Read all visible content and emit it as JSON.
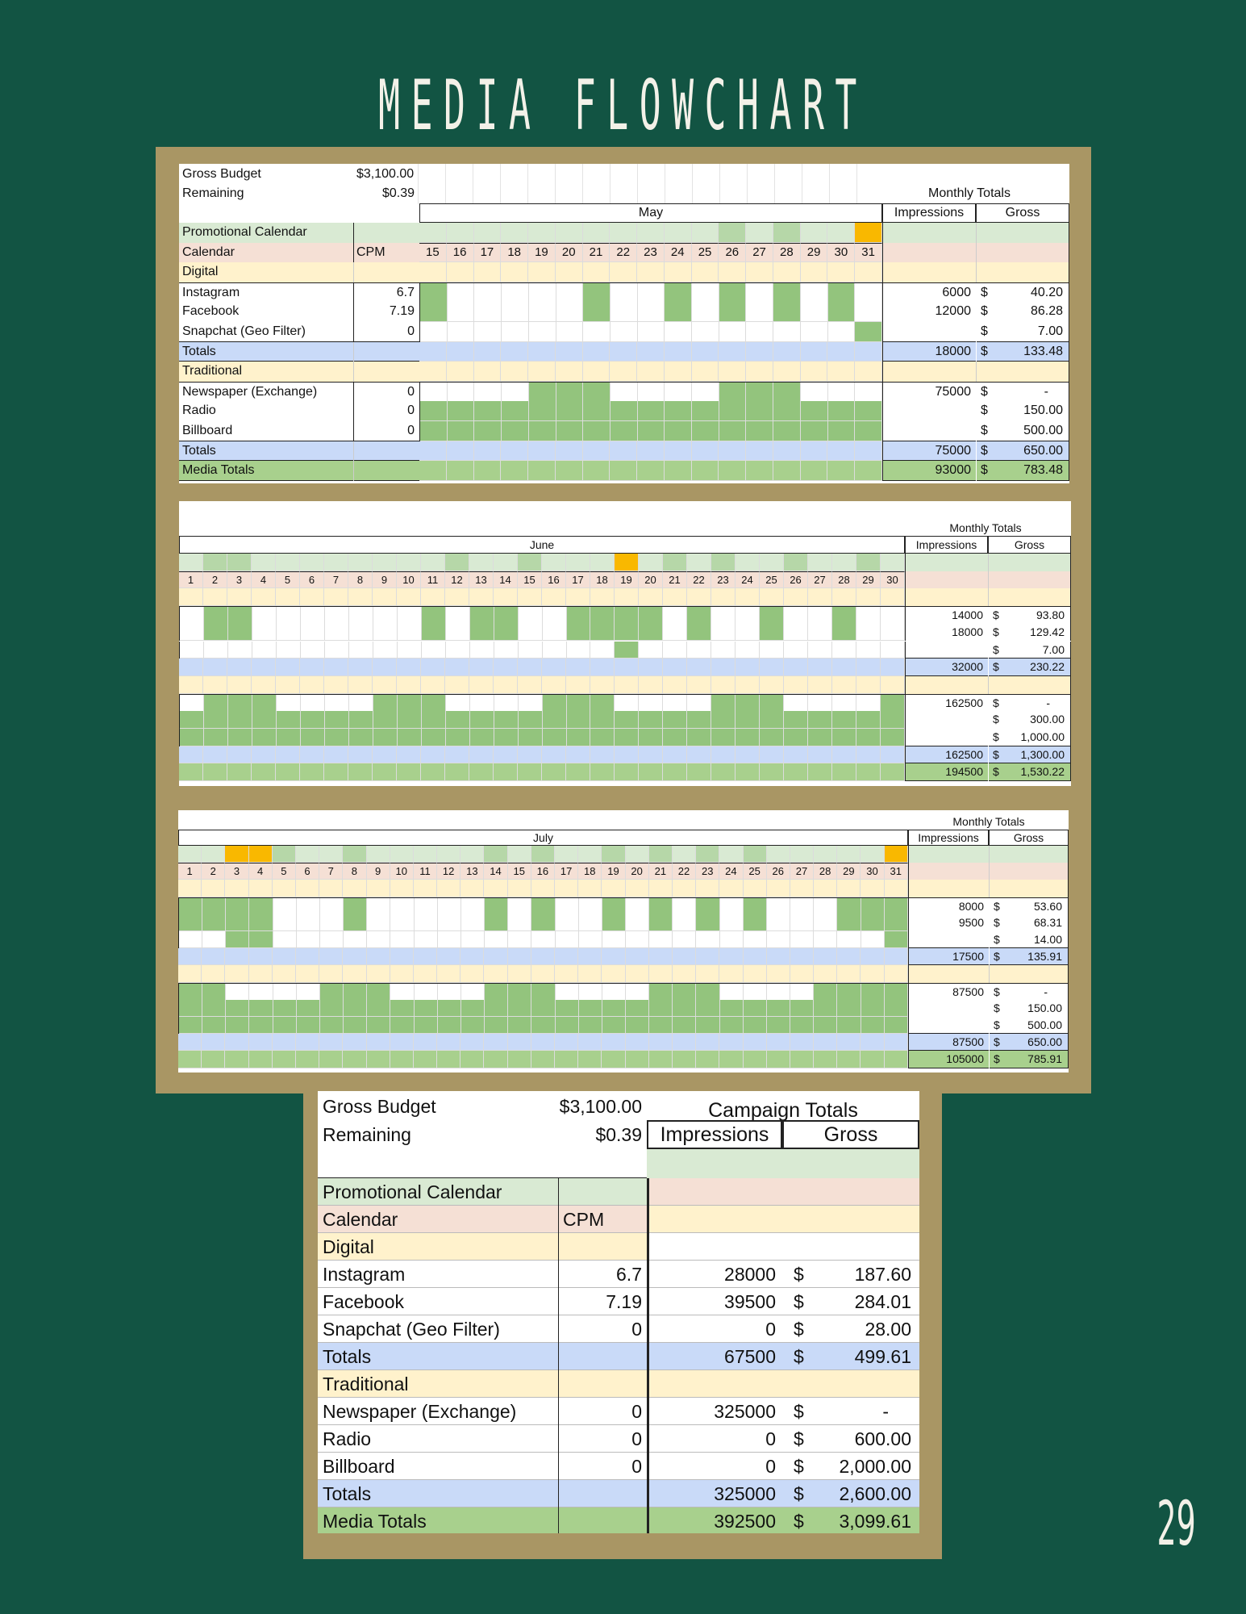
{
  "title": "MEDIA FLOWCHART",
  "page_number": "29",
  "colors": {
    "background": "#125443",
    "frame": "#a99664",
    "active_day": "#93c47d",
    "promo_light": "#d9ead3",
    "promo_mid": "#b6d7a8",
    "highlight_day": "#f9b800",
    "calendar_row": "#f5e0d5",
    "section_row": "#fff2cc",
    "totals_row": "#c9daf8",
    "media_totals_row": "#a8d08d"
  },
  "labels": {
    "gross_budget": "Gross Budget",
    "gross_budget_value": "$3,100.00",
    "remaining": "Remaining",
    "remaining_value": "$0.39",
    "promotional_calendar": "Promotional Calendar",
    "calendar": "Calendar",
    "cpm": "CPM",
    "digital": "Digital",
    "traditional": "Traditional",
    "totals": "Totals",
    "media_totals": "Media Totals",
    "monthly_totals": "Monthly Totals",
    "campaign_totals": "Campaign Totals",
    "impressions": "Impressions",
    "gross": "Gross",
    "currency": "$"
  },
  "media": [
    {
      "name": "Instagram",
      "cpm": "6.7"
    },
    {
      "name": "Facebook",
      "cpm": "7.19"
    },
    {
      "name": "Snapchat (Geo Filter)",
      "cpm": "0"
    },
    {
      "name": "Newspaper (Exchange)",
      "cpm": "0"
    },
    {
      "name": "Radio",
      "cpm": "0"
    },
    {
      "name": "Billboard",
      "cpm": "0"
    }
  ],
  "may": {
    "month": "May",
    "days": [
      "15",
      "16",
      "17",
      "18",
      "19",
      "20",
      "21",
      "22",
      "23",
      "24",
      "25",
      "26",
      "27",
      "28",
      "29",
      "30",
      "31"
    ],
    "promo": [
      0,
      0,
      0,
      0,
      0,
      0,
      0,
      0,
      0,
      0,
      0,
      2,
      0,
      2,
      0,
      0,
      3
    ],
    "schedule": [
      [
        1,
        0,
        0,
        0,
        0,
        0,
        1,
        0,
        0,
        1,
        0,
        1,
        0,
        1,
        0,
        1,
        0
      ],
      [
        1,
        0,
        0,
        0,
        0,
        0,
        1,
        0,
        0,
        1,
        0,
        1,
        0,
        1,
        0,
        1,
        0
      ],
      [
        0,
        0,
        0,
        0,
        0,
        0,
        0,
        0,
        0,
        0,
        0,
        0,
        0,
        0,
        0,
        0,
        1
      ],
      [
        0,
        0,
        0,
        0,
        1,
        1,
        1,
        0,
        0,
        0,
        0,
        1,
        1,
        1,
        0,
        0,
        0
      ],
      [
        1,
        1,
        1,
        1,
        1,
        1,
        1,
        1,
        1,
        1,
        1,
        1,
        1,
        1,
        1,
        1,
        1
      ],
      [
        1,
        1,
        1,
        1,
        1,
        1,
        1,
        1,
        1,
        1,
        1,
        1,
        1,
        1,
        1,
        1,
        1
      ]
    ],
    "values": [
      {
        "impressions": "6000",
        "gross": "40.20"
      },
      {
        "impressions": "12000",
        "gross": "86.28"
      },
      {
        "impressions": "",
        "gross": "7.00"
      },
      {
        "impressions": "18000",
        "gross": "133.48"
      },
      {
        "impressions": "75000",
        "gross": "-"
      },
      {
        "impressions": "",
        "gross": "150.00"
      },
      {
        "impressions": "",
        "gross": "500.00"
      },
      {
        "impressions": "75000",
        "gross": "650.00"
      },
      {
        "impressions": "93000",
        "gross": "783.48"
      }
    ]
  },
  "june": {
    "month": "June",
    "days": [
      "1",
      "2",
      "3",
      "4",
      "5",
      "6",
      "7",
      "8",
      "9",
      "10",
      "11",
      "12",
      "13",
      "14",
      "15",
      "16",
      "17",
      "18",
      "19",
      "20",
      "21",
      "22",
      "23",
      "24",
      "25",
      "26",
      "27",
      "28",
      "29",
      "30"
    ],
    "promo": [
      1,
      2,
      2,
      1,
      1,
      1,
      1,
      1,
      1,
      1,
      1,
      2,
      1,
      1,
      2,
      1,
      1,
      1,
      3,
      1,
      2,
      1,
      2,
      1,
      1,
      2,
      1,
      1,
      2,
      1
    ],
    "schedule": [
      [
        0,
        1,
        1,
        0,
        0,
        0,
        0,
        0,
        0,
        0,
        1,
        0,
        1,
        1,
        0,
        0,
        1,
        1,
        1,
        1,
        0,
        1,
        0,
        0,
        1,
        0,
        0,
        1,
        0,
        0
      ],
      [
        0,
        1,
        1,
        0,
        0,
        0,
        0,
        0,
        0,
        0,
        1,
        0,
        1,
        1,
        0,
        0,
        1,
        1,
        1,
        1,
        0,
        1,
        0,
        0,
        1,
        0,
        0,
        1,
        0,
        0
      ],
      [
        0,
        0,
        0,
        0,
        0,
        0,
        0,
        0,
        0,
        0,
        0,
        0,
        0,
        0,
        0,
        0,
        0,
        0,
        1,
        0,
        0,
        0,
        0,
        0,
        0,
        0,
        0,
        0,
        0,
        0
      ],
      [
        0,
        1,
        1,
        1,
        0,
        0,
        0,
        0,
        1,
        1,
        1,
        0,
        0,
        0,
        0,
        1,
        1,
        1,
        0,
        0,
        0,
        0,
        1,
        1,
        1,
        0,
        0,
        0,
        0,
        1
      ],
      [
        1,
        1,
        1,
        1,
        1,
        1,
        1,
        1,
        1,
        1,
        1,
        1,
        1,
        1,
        1,
        1,
        1,
        1,
        1,
        1,
        1,
        1,
        1,
        1,
        1,
        1,
        1,
        1,
        1,
        1
      ],
      [
        1,
        1,
        1,
        1,
        1,
        1,
        1,
        1,
        1,
        1,
        1,
        1,
        1,
        1,
        1,
        1,
        1,
        1,
        1,
        1,
        1,
        1,
        1,
        1,
        1,
        1,
        1,
        1,
        1,
        1
      ]
    ],
    "values": [
      {
        "impressions": "14000",
        "gross": "93.80"
      },
      {
        "impressions": "18000",
        "gross": "129.42"
      },
      {
        "impressions": "",
        "gross": "7.00"
      },
      {
        "impressions": "32000",
        "gross": "230.22"
      },
      {
        "impressions": "162500",
        "gross": "-"
      },
      {
        "impressions": "",
        "gross": "300.00"
      },
      {
        "impressions": "",
        "gross": "1,000.00"
      },
      {
        "impressions": "162500",
        "gross": "1,300.00"
      },
      {
        "impressions": "194500",
        "gross": "1,530.22"
      }
    ]
  },
  "july": {
    "month": "July",
    "days": [
      "1",
      "2",
      "3",
      "4",
      "5",
      "6",
      "7",
      "8",
      "9",
      "10",
      "11",
      "12",
      "13",
      "14",
      "15",
      "16",
      "17",
      "18",
      "19",
      "20",
      "21",
      "22",
      "23",
      "24",
      "25",
      "26",
      "27",
      "28",
      "29",
      "30",
      "31"
    ],
    "promo": [
      1,
      1,
      3,
      3,
      2,
      1,
      1,
      2,
      1,
      1,
      1,
      1,
      1,
      2,
      1,
      2,
      1,
      1,
      2,
      1,
      2,
      1,
      2,
      1,
      2,
      1,
      1,
      1,
      1,
      1,
      3
    ],
    "schedule": [
      [
        1,
        1,
        1,
        1,
        0,
        0,
        0,
        1,
        0,
        0,
        0,
        0,
        0,
        1,
        0,
        1,
        0,
        0,
        1,
        0,
        1,
        0,
        1,
        0,
        1,
        0,
        0,
        0,
        1,
        1,
        1
      ],
      [
        1,
        1,
        1,
        1,
        0,
        0,
        0,
        1,
        0,
        0,
        0,
        0,
        0,
        1,
        0,
        1,
        0,
        0,
        1,
        0,
        1,
        0,
        1,
        0,
        1,
        0,
        0,
        0,
        1,
        1,
        1
      ],
      [
        0,
        0,
        1,
        1,
        0,
        0,
        0,
        0,
        0,
        0,
        0,
        0,
        0,
        0,
        0,
        0,
        0,
        0,
        0,
        0,
        0,
        0,
        0,
        0,
        0,
        0,
        0,
        0,
        0,
        0,
        1
      ],
      [
        1,
        1,
        0,
        0,
        0,
        0,
        1,
        1,
        1,
        0,
        0,
        0,
        0,
        1,
        1,
        1,
        0,
        0,
        0,
        0,
        1,
        1,
        1,
        0,
        0,
        0,
        0,
        1,
        1,
        1,
        1
      ],
      [
        1,
        1,
        1,
        1,
        1,
        1,
        1,
        1,
        1,
        1,
        1,
        1,
        1,
        1,
        1,
        1,
        1,
        1,
        1,
        1,
        1,
        1,
        1,
        1,
        1,
        1,
        1,
        1,
        1,
        1,
        1
      ],
      [
        1,
        1,
        1,
        1,
        1,
        1,
        1,
        1,
        1,
        1,
        1,
        1,
        1,
        1,
        1,
        1,
        1,
        1,
        1,
        1,
        1,
        1,
        1,
        1,
        1,
        1,
        1,
        1,
        1,
        1,
        1
      ]
    ],
    "values": [
      {
        "impressions": "8000",
        "gross": "53.60"
      },
      {
        "impressions": "9500",
        "gross": "68.31"
      },
      {
        "impressions": "",
        "gross": "14.00"
      },
      {
        "impressions": "17500",
        "gross": "135.91"
      },
      {
        "impressions": "87500",
        "gross": "-"
      },
      {
        "impressions": "",
        "gross": "150.00"
      },
      {
        "impressions": "",
        "gross": "500.00"
      },
      {
        "impressions": "87500",
        "gross": "650.00"
      },
      {
        "impressions": "105000",
        "gross": "785.91"
      }
    ]
  },
  "campaign": {
    "values": [
      {
        "impressions": "28000",
        "gross": "187.60"
      },
      {
        "impressions": "39500",
        "gross": "284.01"
      },
      {
        "impressions": "0",
        "gross": "28.00"
      },
      {
        "impressions": "67500",
        "gross": "499.61"
      },
      {
        "impressions": "325000",
        "gross": "-"
      },
      {
        "impressions": "0",
        "gross": "600.00"
      },
      {
        "impressions": "0",
        "gross": "2,000.00"
      },
      {
        "impressions": "325000",
        "gross": "2,600.00"
      },
      {
        "impressions": "392500",
        "gross": "3,099.61"
      }
    ]
  }
}
